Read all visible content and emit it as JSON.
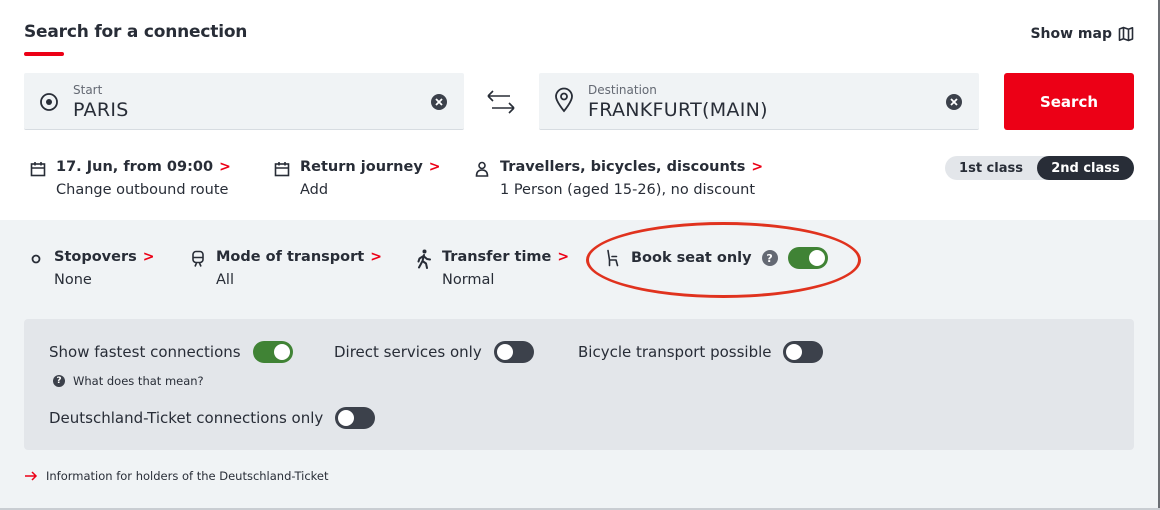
{
  "header": {
    "title": "Search for a connection",
    "show_map_label": "Show map"
  },
  "start": {
    "label": "Start",
    "value": "PARIS"
  },
  "destination": {
    "label": "Destination",
    "value": "FRANKFURT(MAIN)"
  },
  "search_button_label": "Search",
  "outbound": {
    "main": "17. Jun, from 09:00",
    "sub": "Change outbound route"
  },
  "return_journey": {
    "main": "Return journey",
    "sub": "Add"
  },
  "travellers": {
    "main": "Travellers, bicycles, discounts",
    "sub": "1 Person (aged 15-26), no discount"
  },
  "travel_class": {
    "first": "1st class",
    "second": "2nd class",
    "selected": "2nd class"
  },
  "stopovers": {
    "main": "Stopovers",
    "sub": "None"
  },
  "mode_of_transport": {
    "main": "Mode of transport",
    "sub": "All"
  },
  "transfer_time": {
    "main": "Transfer time",
    "sub": "Normal"
  },
  "book_seat_only": {
    "label": "Book seat only",
    "help_glyph": "?",
    "enabled": true
  },
  "filters": {
    "fastest": {
      "label": "Show fastest connections",
      "enabled": true
    },
    "direct": {
      "label": "Direct services only",
      "enabled": false
    },
    "bicycle": {
      "label": "Bicycle transport possible",
      "enabled": false
    },
    "deutschland_ticket": {
      "label": "Deutschland-Ticket connections only",
      "enabled": false
    },
    "what_does_that_mean": "What does that mean?",
    "help_glyph": "?"
  },
  "info_link": "Information for holders of the Deutschland-Ticket",
  "colors": {
    "brand_red": "#ec0016",
    "toggle_on": "#408335",
    "toggle_off": "#3c414b",
    "text": "#282d37",
    "panel_bg": "#f0f3f5",
    "highlight_circle": "#e0321e"
  },
  "icons": {
    "map": "map-icon",
    "start": "target-circle-icon",
    "destination": "location-pin-icon",
    "clear": "close-icon",
    "swap": "swap-arrows-icon",
    "calendar": "calendar-icon",
    "person": "person-icon",
    "stopover": "stopover-circle-icon",
    "transport": "train-icon",
    "walk": "walking-person-icon",
    "seat": "seat-icon",
    "arrow": "arrow-right-icon"
  }
}
